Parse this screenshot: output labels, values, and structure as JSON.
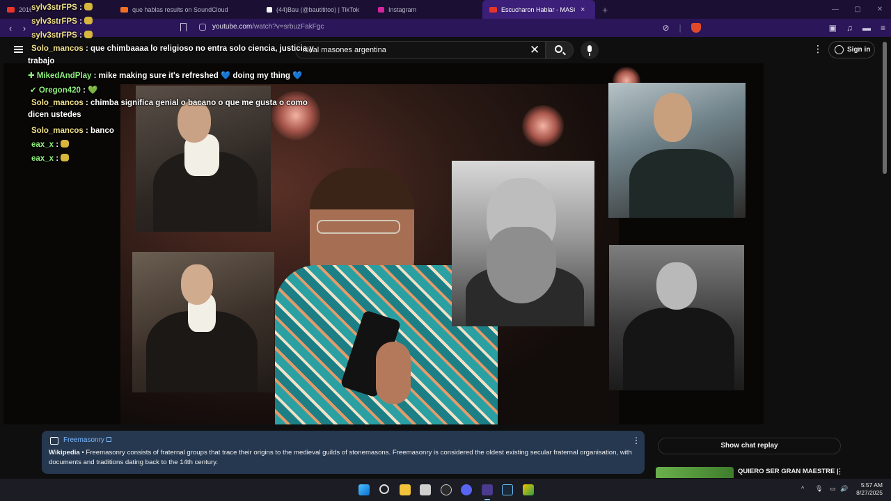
{
  "browser": {
    "tabs": [
      {
        "label": "2016",
        "favicon": "youtube-icon",
        "color": "#e8342b"
      },
      {
        "label": "que hablas results on SoundCloud",
        "favicon": "soundcloud-icon",
        "color": "#f26f23"
      },
      {
        "label": "(44)Bau (@bautititoo) | TikTok",
        "favicon": "tiktok-icon",
        "color": "#ffffff"
      },
      {
        "label": "Instagram",
        "favicon": "instagram-icon",
        "color": "#d6249f"
      },
      {
        "label": "Escucharon Hablar - MASONI",
        "favicon": "youtube-icon",
        "color": "#e8342b",
        "active": true,
        "close": "×"
      }
    ],
    "new_tab": "+",
    "window_controls": {
      "minimize": "—",
      "maximize": "▢",
      "close": "✕"
    },
    "nav": {
      "back": "‹",
      "forward": "›"
    },
    "url_domain": "youtube.com",
    "url_path": "/watch?v=srbuzFakFgc",
    "addr_icons": {
      "shield_off": "⊘",
      "separator": "|",
      "reader": "▣",
      "music": "♫",
      "vpn": "▬",
      "menu": "≡"
    }
  },
  "youtube": {
    "search_value": "ideal masones argentina",
    "clear_glyph": "✕",
    "more_glyph": "⋮",
    "sign_in_label": "Sign in"
  },
  "chat": [
    {
      "user": "sylv3strFPS",
      "user_class": "u-yellow",
      "text": ":",
      "emoji": true
    },
    {
      "user": "sylv3strFPS",
      "user_class": "u-yellow",
      "text": ":",
      "emoji": true
    },
    {
      "user": "sylv3strFPS",
      "user_class": "u-yellow",
      "text": ":",
      "emoji": true
    },
    {
      "user": "Solo_mancos",
      "user_class": "u-yellow",
      "text": ": que chimbaaaa lo religioso no entra solo ciencia, justicia y trabajo"
    },
    {
      "badge": "✚",
      "user": "MikedAndPlay",
      "user_class": "u-green",
      "text": ": mike making sure it's refreshed",
      "tail": "💙 doing my thing 💙"
    },
    {
      "badge": "✔",
      "user": "Oregon420",
      "user_class": "u-green",
      "text": ":",
      "tail": "💚"
    },
    {
      "user": "Solo_mancos",
      "user_class": "u-yellow",
      "text": ": chimba significa genial o bacano o que me gusta o como dicen ustedes"
    },
    {
      "user": "Solo_mancos",
      "user_class": "u-yellow",
      "text": ": banco"
    },
    {
      "user": "eax_x",
      "user_class": "u-green",
      "text": ":",
      "emoji": true
    },
    {
      "user": "eax_x",
      "user_class": "u-green",
      "text": ":",
      "emoji": true
    }
  ],
  "wiki": {
    "title": "Freemasonry",
    "source": "Wikipedia",
    "bullet": " • ",
    "text": "Freemasonry consists of fraternal groups that trace their origins to the medieval guilds of stonemasons. Freemasonry is considered the oldest existing secular fraternal organisation, with documents and traditions dating back to the 14th century.",
    "more_glyph": "⋮"
  },
  "sidebar": {
    "show_chat_replay": "Show chat replay",
    "recommendation_title": "QUIERO SER GRAN MAESTRE |",
    "more_glyph": "⋮"
  },
  "taskbar": {
    "tray": {
      "chevron": "^",
      "mic": "🎙",
      "display": "▭",
      "volume": "🔊"
    },
    "time": "5:57 AM",
    "date": "8/27/2025"
  },
  "colors": {
    "tab_active": "#3b1f78",
    "address_bar": "#2a1659",
    "wiki_panel": "#263850",
    "link": "#7ab8ff"
  }
}
